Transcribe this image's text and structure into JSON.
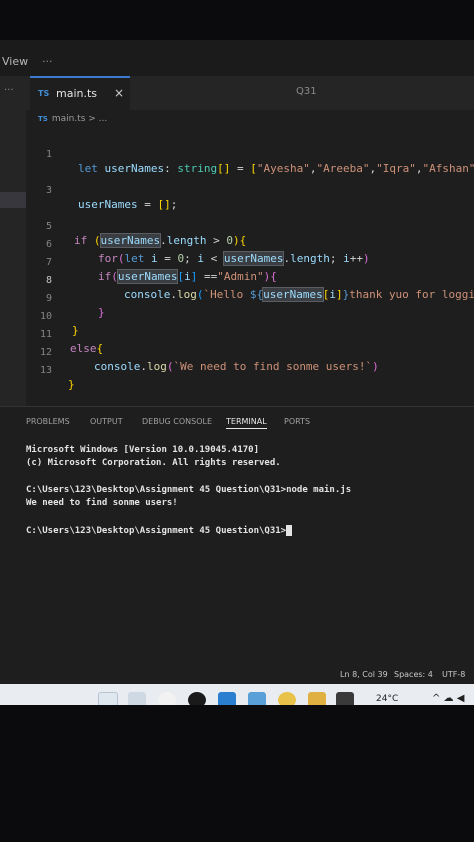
{
  "menubar": {
    "view_label": "View",
    "more_label": "..."
  },
  "sidebar_dots": "...",
  "tabs": [
    {
      "icon": "TS",
      "label": "main.ts",
      "close": "×"
    }
  ],
  "tab_right_label": "Q31",
  "breadcrumb": {
    "icon": "TS",
    "text": "main.ts > ..."
  },
  "editor": {
    "line_numbers": [
      "1",
      "",
      "3",
      "",
      "5",
      "6",
      "7",
      "8",
      "9",
      "10",
      "11",
      "12",
      "13"
    ]
  },
  "panel": {
    "tabs": [
      "PROBLEMS",
      "OUTPUT",
      "DEBUG CONSOLE",
      "TERMINAL",
      "PORTS"
    ],
    "active_tab": "TERMINAL"
  },
  "terminal": {
    "lines": [
      "Microsoft Windows [Version 10.0.19045.4170]",
      "(c) Microsoft Corporation. All rights reserved.",
      "C:\\Users\\123\\Desktop\\Assignment 45 Question\\Q31>node main.js",
      "We need to find sonme users!",
      "C:\\Users\\123\\Desktop\\Assignment 45 Question\\Q31>"
    ]
  },
  "statusbar": {
    "position": "Ln 8, Col 39",
    "spaces": "Spaces: 4",
    "encoding": "UTF-8"
  },
  "taskbar": {
    "weather": "24°C",
    "tray": "^ ☁ ◀",
    "accent": "#e9ecf1"
  },
  "colors": {
    "editor_bg": "#1e1e1e",
    "keyword": "#569cd6",
    "string": "#ce9178",
    "variable": "#9cdcfe"
  }
}
